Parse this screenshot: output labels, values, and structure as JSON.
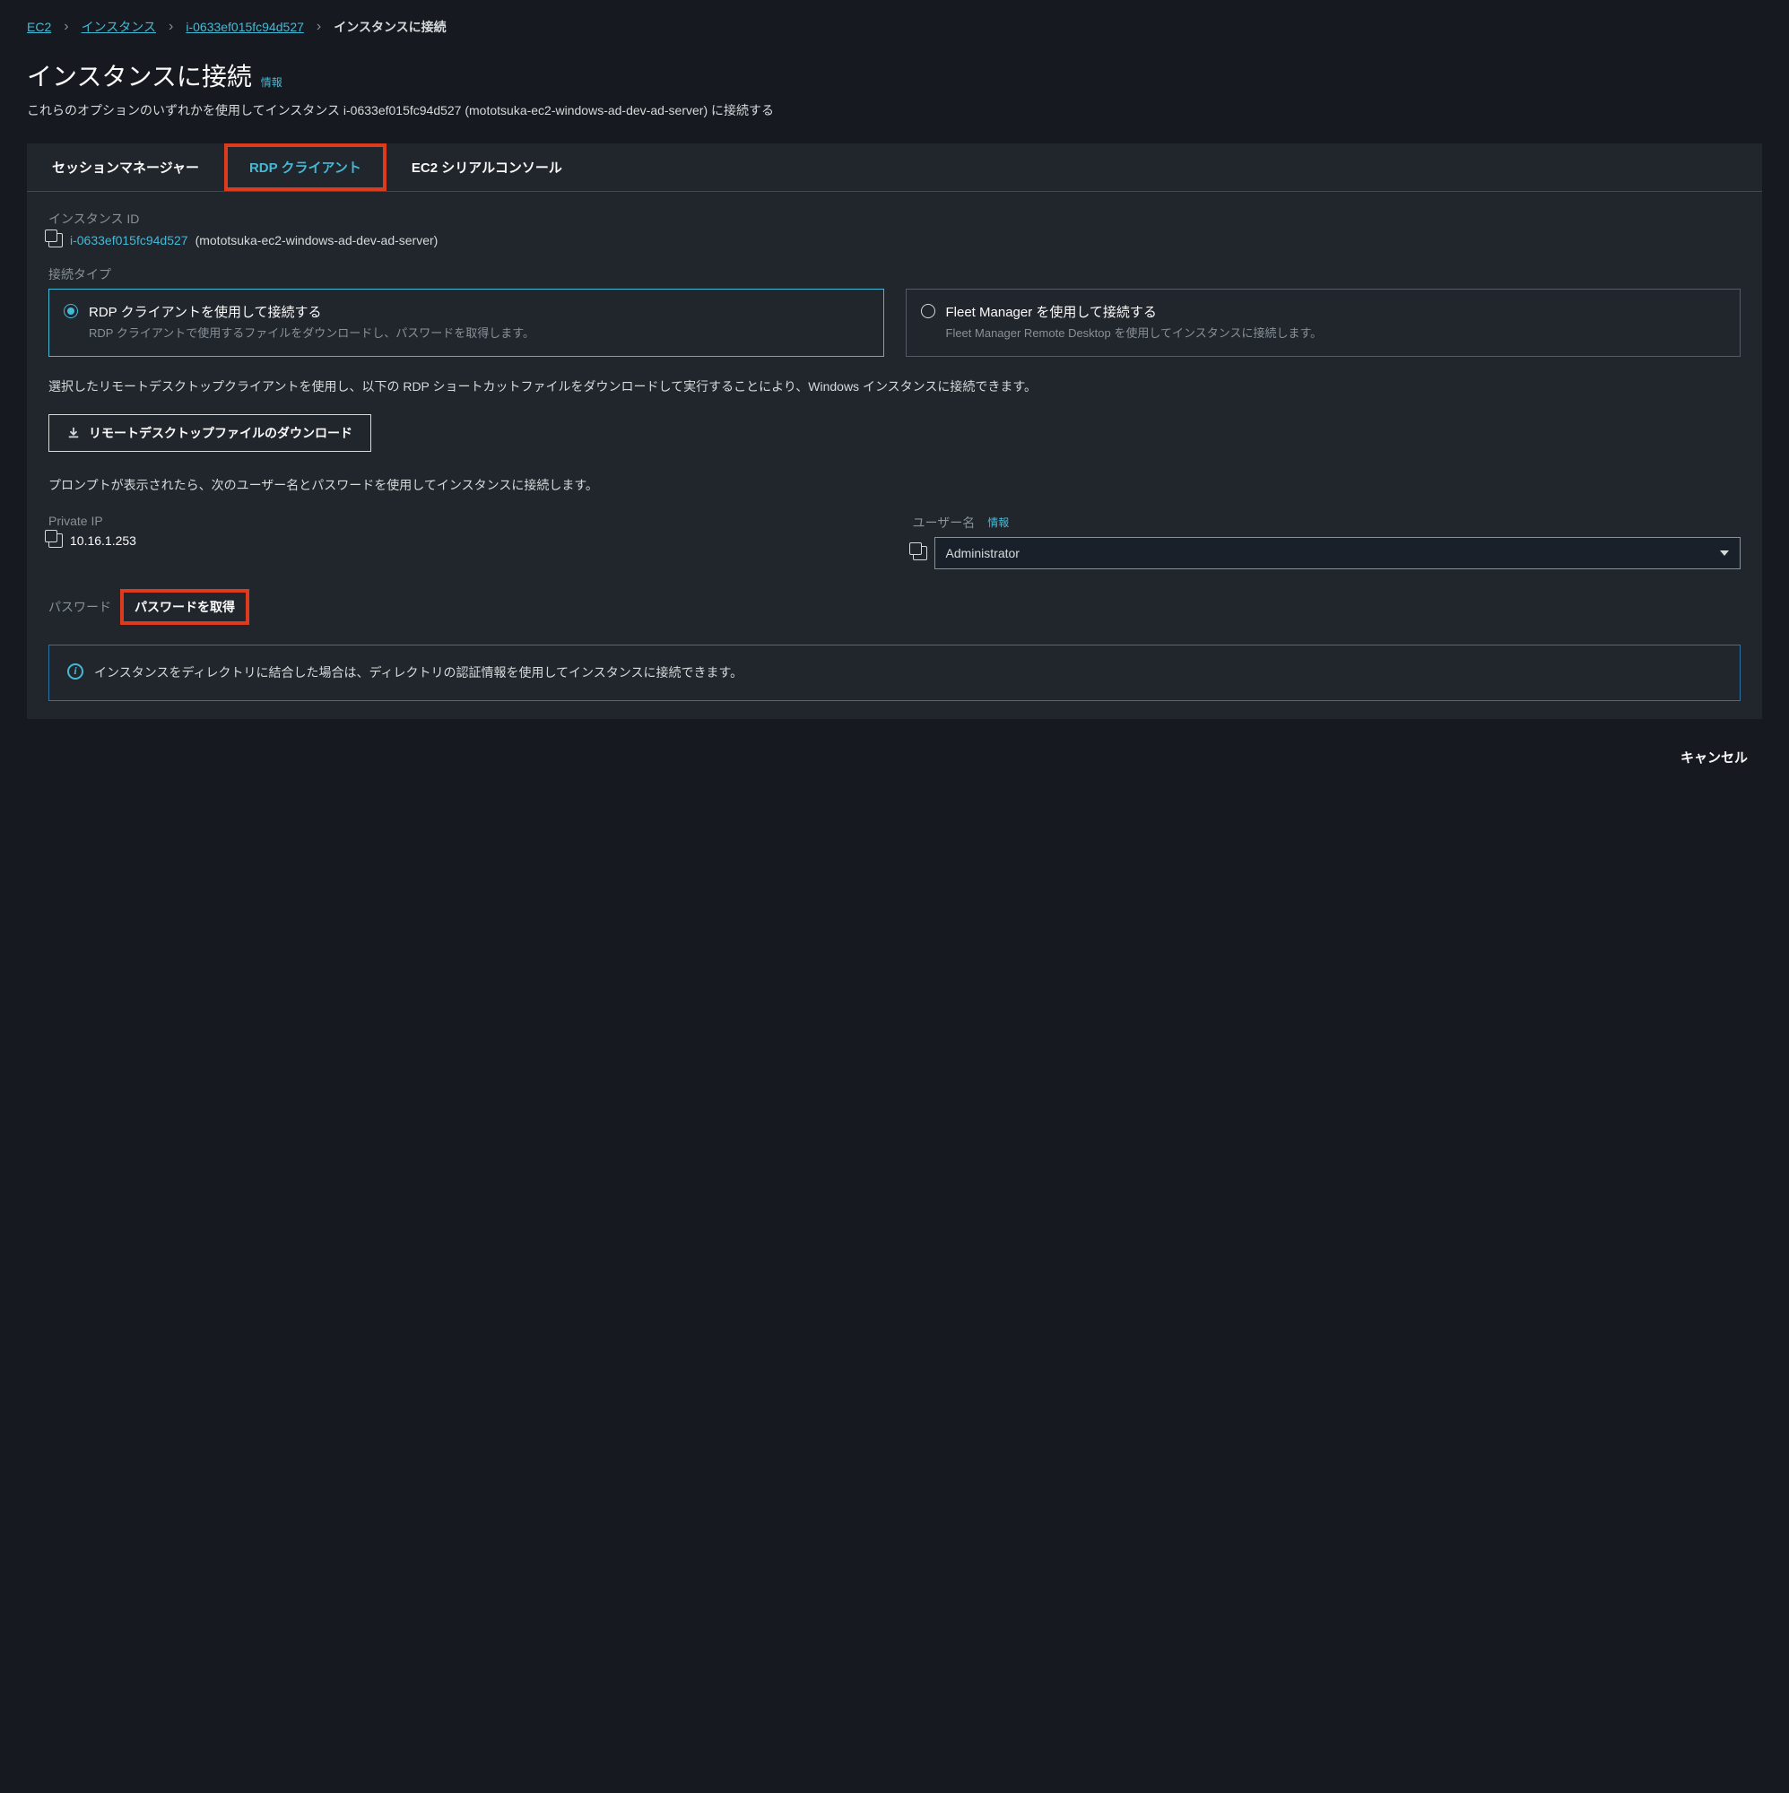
{
  "breadcrumb": {
    "ec2": "EC2",
    "instances": "インスタンス",
    "instance_id": "i-0633ef015fc94d527",
    "current": "インスタンスに接続"
  },
  "page": {
    "title": "インスタンスに接続",
    "info": "情報",
    "description": "これらのオプションのいずれかを使用してインスタンス i-0633ef015fc94d527 (mototsuka-ec2-windows-ad-dev-ad-server) に接続する"
  },
  "tabs": {
    "session_manager": "セッションマネージャー",
    "rdp_client": "RDP クライアント",
    "serial_console": "EC2 シリアルコンソール"
  },
  "instance_id_section": {
    "label": "インスタンス ID",
    "id": "i-0633ef015fc94d527",
    "name": "(mototsuka-ec2-windows-ad-dev-ad-server)"
  },
  "connection_type": {
    "label": "接続タイプ",
    "rdp_option": {
      "title": "RDP クライアントを使用して接続する",
      "desc": "RDP クライアントで使用するファイルをダウンロードし、パスワードを取得します。"
    },
    "fleet_option": {
      "title": "Fleet Manager を使用して接続する",
      "desc": "Fleet Manager Remote Desktop を使用してインスタンスに接続します。"
    }
  },
  "instruction1": "選択したリモートデスクトップクライアントを使用し、以下の RDP ショートカットファイルをダウンロードして実行することにより、Windows インスタンスに接続できます。",
  "download_button": "リモートデスクトップファイルのダウンロード",
  "instruction2": "プロンプトが表示されたら、次のユーザー名とパスワードを使用してインスタンスに接続します。",
  "private_ip": {
    "label": "Private IP",
    "value": "10.16.1.253"
  },
  "username": {
    "label": "ユーザー名",
    "info": "情報",
    "value": "Administrator"
  },
  "password": {
    "label": "パスワード",
    "get_button": "パスワードを取得"
  },
  "info_box": "インスタンスをディレクトリに結合した場合は、ディレクトリの認証情報を使用してインスタンスに接続できます。",
  "footer": {
    "cancel": "キャンセル"
  }
}
